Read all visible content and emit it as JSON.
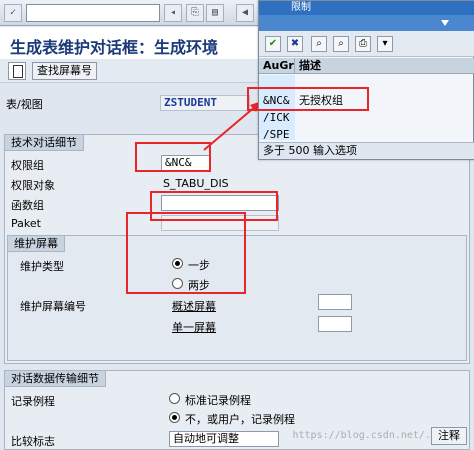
{
  "window": {
    "title": "生成表维护对话框：生成环境"
  },
  "app_toolbar": {
    "find_screen_label": "查找屏幕号"
  },
  "form": {
    "table_view_label": "表/视图",
    "table_view_value": "ZSTUDENT",
    "tech_section_title": "技术对话细节",
    "auth_group_label": "权限组",
    "auth_group_value": "&NC&",
    "auth_object_label": "权限对象",
    "auth_object_value": "S_TABU_DIS",
    "function_group_label": "函数组",
    "function_group_value": "",
    "package_label": "Paket",
    "package_value": ""
  },
  "maintenance": {
    "section_title": "维护屏幕",
    "type_label": "维护类型",
    "option_one_step": "一步",
    "option_two_step": "两步",
    "selected": "一步",
    "screen_no_label": "维护屏幕编号",
    "overview_screen_label": "概述屏幕",
    "single_screen_label": "单一屏幕"
  },
  "transport": {
    "section_title": "对话数据传输细节",
    "recording_label": "记录例程",
    "option_standard": "标准记录例程",
    "option_none": "不，或用户，记录例程",
    "compare_label": "比较标志",
    "compare_value": "自动地可调整",
    "note_button": "注释"
  },
  "popup": {
    "title": "限制",
    "col_key": "AuGr",
    "col_desc": "描述",
    "rows": [
      {
        "key": "",
        "desc": ""
      },
      {
        "key": "&NC&",
        "desc": "无授权组"
      },
      {
        "key": "/ICK",
        "desc": ""
      },
      {
        "key": "/SPE",
        "desc": ""
      }
    ],
    "status": "多于 500 输入选项"
  },
  "watermark": "https://blog.csdn.net/...",
  "colors": {
    "highlight_red": "#e8262a",
    "title_blue": "#1a3a78",
    "popup_header": "#2e6fbf"
  }
}
